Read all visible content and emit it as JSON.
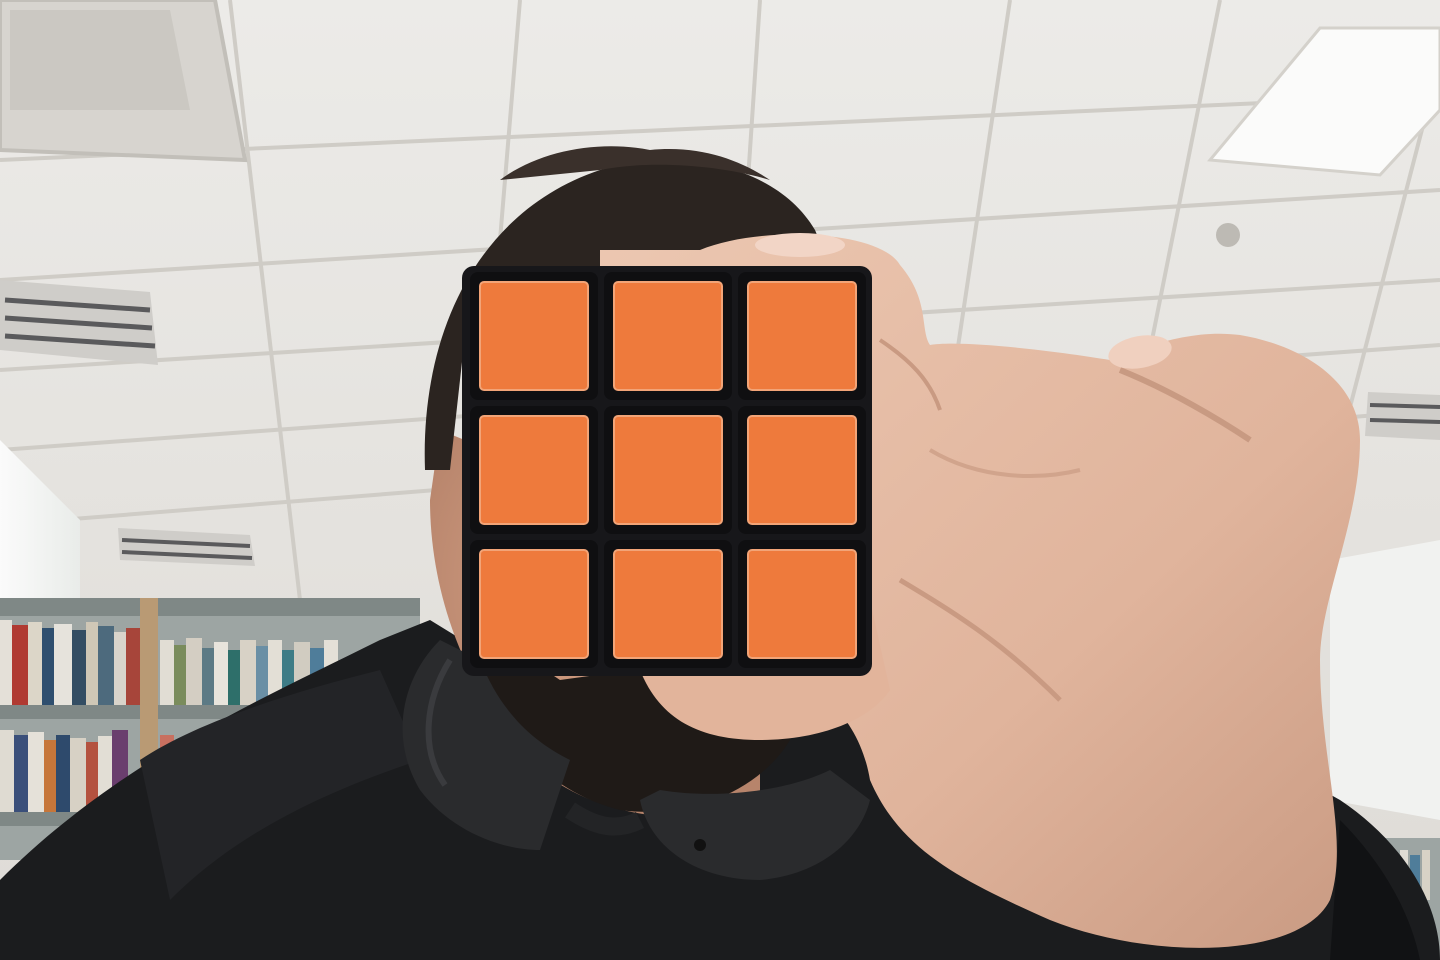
{
  "scene": {
    "subject": "person-holding-cube",
    "setting": "library-ceiling-and-bookshelves",
    "colors": {
      "ceiling": "#e8e6e2",
      "ceiling_grid": "#cfccc6",
      "light_panel": "#fbfbfa",
      "hair": "#2b2420",
      "beard": "#1f1a17",
      "hoodie": "#1b1c1e",
      "headphones": "#2a2b2d",
      "skin": "#e3b9a2",
      "skin_shadow": "#c89a82",
      "shelf": "#b99a74",
      "cube_body": "#17171a",
      "sticker": "#ee7a3c"
    }
  },
  "cube": {
    "face_color_name": "orange",
    "grid": [
      [
        "orange",
        "orange",
        "orange"
      ],
      [
        "orange",
        "orange",
        "orange"
      ],
      [
        "orange",
        "orange",
        "orange"
      ]
    ]
  }
}
